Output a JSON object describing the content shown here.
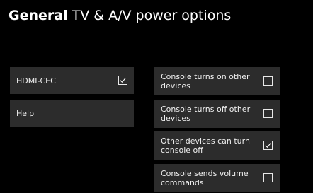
{
  "header": {
    "section": "General",
    "subtitle": "TV & A/V power options"
  },
  "left_items": [
    {
      "label": "HDMI-CEC",
      "checked": true
    },
    {
      "label": "Help"
    }
  ],
  "right_items": [
    {
      "label": "Console turns on other devices",
      "checked": false
    },
    {
      "label": "Console turns off other devices",
      "checked": false
    },
    {
      "label": "Other devices can turn console off",
      "checked": true
    },
    {
      "label": "Console sends volume commands",
      "checked": false
    }
  ]
}
